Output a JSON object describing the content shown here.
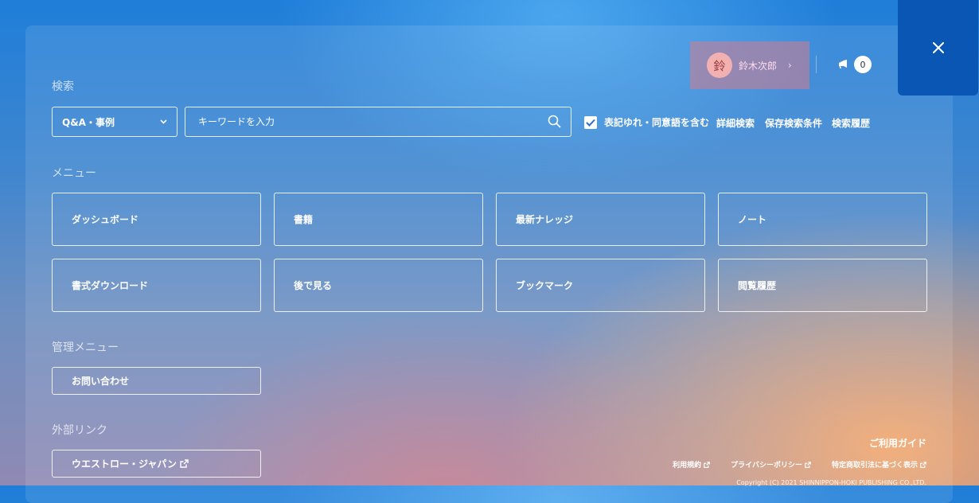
{
  "header": {
    "close_icon": "close-icon",
    "user": {
      "avatar_char": "鈴",
      "name": "鈴木次郎",
      "chevron": "›"
    },
    "notifications": {
      "icon": "megaphone-icon",
      "count": "0"
    }
  },
  "search": {
    "section_title": "検索",
    "category_selected": "Q&A・事例",
    "placeholder": "キーワードを入力",
    "synonym_checkbox": {
      "label": "表記ゆれ・同意語を含む",
      "checked": true
    },
    "links": [
      "詳細検索",
      "保存検索条件",
      "検索履歴"
    ]
  },
  "menu": {
    "section_title": "メニュー",
    "items": [
      "ダッシュボード",
      "書籍",
      "最新ナレッジ",
      "ノート",
      "書式ダウンロード",
      "後で見る",
      "ブックマーク",
      "閲覧履歴"
    ]
  },
  "admin_menu": {
    "section_title": "管理メニュー",
    "items": [
      "お問い合わせ"
    ]
  },
  "external_links": {
    "section_title": "外部リンク",
    "items": [
      "ウエストロー・ジャパン"
    ]
  },
  "footer": {
    "guide_title": "ご利用ガイド",
    "links": [
      "利用規約",
      "プライバシーポリシー",
      "特定商取引法に基づく表示"
    ],
    "copyright": "Copyright (C) 2021 SHINNIPPON-HOKI PUBLISHING CO.,LTD."
  }
}
